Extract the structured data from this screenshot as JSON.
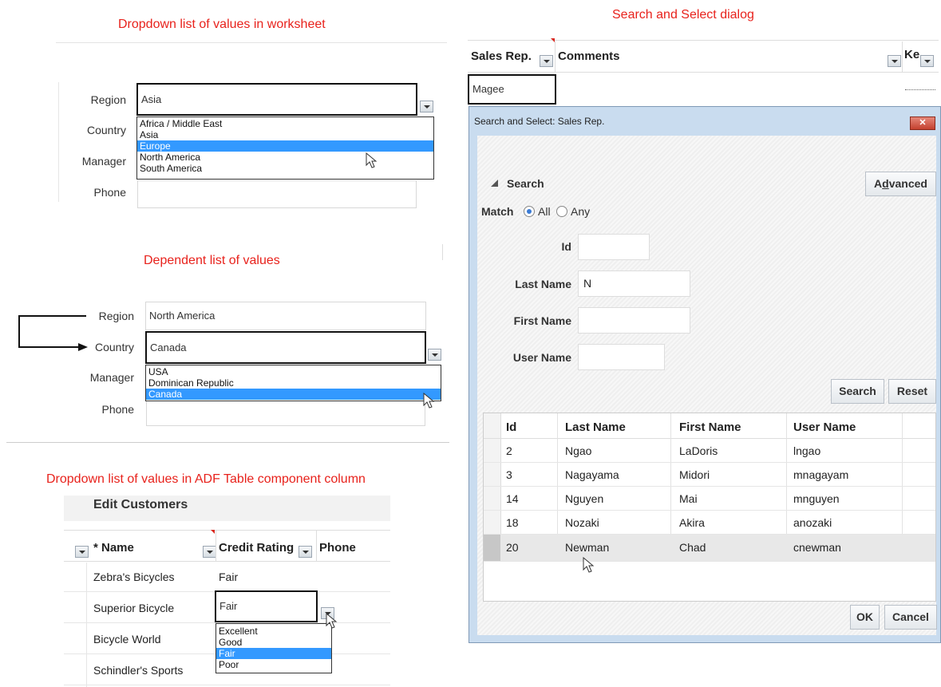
{
  "sections": {
    "worksheet_title": "Dropdown list of values in worksheet",
    "search_title": "Search and Select dialog",
    "dependent_title": "Dependent list of values",
    "adf_title": "Dropdown list of values in ADF Table component column"
  },
  "worksheet": {
    "labels": {
      "region": "Region",
      "country": "Country",
      "manager": "Manager",
      "phone": "Phone"
    },
    "region_value": "Asia",
    "options": [
      "Africa / Middle East",
      "Asia",
      "Europe",
      "North America",
      "South America"
    ],
    "selected_option": "Europe"
  },
  "dependent": {
    "labels": {
      "region": "Region",
      "country": "Country",
      "manager": "Manager",
      "phone": "Phone"
    },
    "region_value": "North America",
    "country_value": "Canada",
    "options": [
      "USA",
      "Dominican Republic",
      "Canada"
    ],
    "selected_option": "Canada"
  },
  "adf": {
    "panel_title": "Edit Customers",
    "columns": {
      "name": "* Name",
      "credit": "Credit Rating",
      "phone": "Phone"
    },
    "rows": [
      {
        "name": "Zebra's Bicycles",
        "credit": "Fair"
      },
      {
        "name": "Superior Bicycle",
        "credit": "Fair"
      },
      {
        "name": "Bicycle World",
        "credit": ""
      },
      {
        "name": "Schindler's Sports",
        "credit": ""
      }
    ],
    "options": [
      "Excellent",
      "Good",
      "Fair",
      "Poor"
    ],
    "selected_option": "Fair"
  },
  "search_grid": {
    "columns": {
      "sales_rep": "Sales Rep.",
      "comments": "Comments",
      "ke": "Ke"
    },
    "sales_rep_value": "Magee"
  },
  "dialog": {
    "title": "Search and Select: Sales Rep.",
    "close_symbol": "✕",
    "search_header": "Search",
    "advanced_label_pre": "A",
    "advanced_label_key": "d",
    "advanced_label_post": "vanced",
    "match_label": "Match",
    "match_all": "All",
    "match_any": "Any",
    "fields": {
      "id": "Id",
      "last_name": "Last Name",
      "first_name": "First Name",
      "user_name": "User Name"
    },
    "values": {
      "id": "",
      "last_name": "N",
      "first_name": "",
      "user_name": ""
    },
    "search_button": "Search",
    "reset_button": "Reset",
    "results_columns": [
      "Id",
      "Last Name",
      "First Name",
      "User Name"
    ],
    "results": [
      [
        "2",
        "Ngao",
        "LaDoris",
        "lngao"
      ],
      [
        "3",
        "Nagayama",
        "Midori",
        "mnagayam"
      ],
      [
        "14",
        "Nguyen",
        "Mai",
        "mnguyen"
      ],
      [
        "18",
        "Nozaki",
        "Akira",
        "anozaki"
      ],
      [
        "20",
        "Newman",
        "Chad",
        "cnewman"
      ]
    ],
    "ok_button": "OK",
    "cancel_button": "Cancel"
  },
  "colors": {
    "title_red": "#e8221c",
    "selection_blue": "#3399ff"
  }
}
